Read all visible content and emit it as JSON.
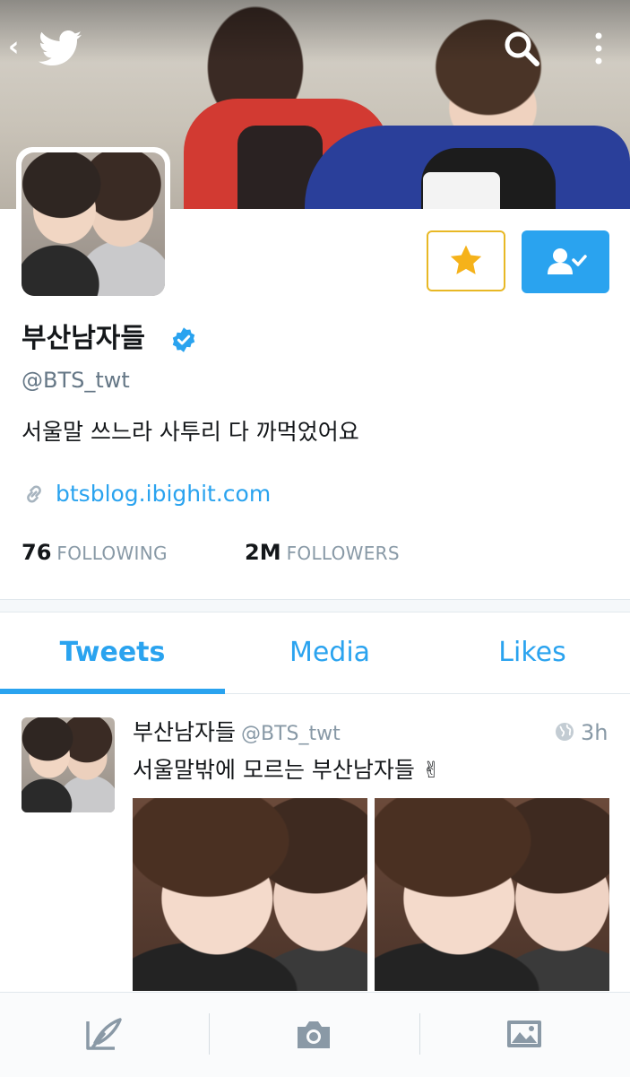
{
  "colors": {
    "accent": "#2aa3ef",
    "favorite_border": "#e8b825",
    "star": "#f5b21a",
    "muted": "#8899a6"
  },
  "header": {
    "icons": [
      "back-chevron-icon",
      "twitter-bird-icon",
      "search-icon",
      "more-vertical-icon"
    ]
  },
  "profile": {
    "display_name": "부산남자들",
    "verified": true,
    "handle": "@BTS_twt",
    "bio": "서울말 쓰느라 사투리 다 까먹었어요",
    "link": "btsblog.ibighit.com",
    "following_count": "76",
    "following_label": "FOLLOWING",
    "followers_count": "2M",
    "followers_label": "FOLLOWERS"
  },
  "tabs": [
    {
      "label": "Tweets",
      "active": true
    },
    {
      "label": "Media",
      "active": false
    },
    {
      "label": "Likes",
      "active": false
    }
  ],
  "tweet": {
    "name": "부산남자들",
    "handle": "@BTS_twt",
    "time": "3h",
    "text": "서울말밖에 모르는 부산남자들 ✌",
    "photo_count": 2
  },
  "bottom_bar": {
    "icons": [
      "compose-tweet-icon",
      "camera-icon",
      "photo-gallery-icon"
    ]
  }
}
